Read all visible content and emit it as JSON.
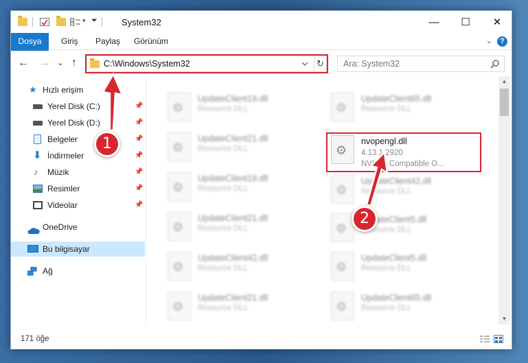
{
  "window": {
    "title": "System32",
    "controls": {
      "minimize": "—",
      "maximize": "☐",
      "close": "✕"
    }
  },
  "ribbon": {
    "tabs": [
      "Dosya",
      "Giriş",
      "Paylaş",
      "Görünüm"
    ],
    "help": "?"
  },
  "nav": {
    "back": "←",
    "forward": "→",
    "recent": "⌄",
    "up": "↑",
    "address": "C:\\Windows\\System32",
    "refresh": "↻",
    "search_placeholder": "Ara: System32"
  },
  "sidebar": {
    "items": [
      {
        "label": "Hızlı erişim",
        "icon": "star-icon",
        "pinned": false
      },
      {
        "label": "Yerel Disk (C:)",
        "icon": "drive-icon",
        "pinned": true
      },
      {
        "label": "Yerel Disk (D:)",
        "icon": "drive-icon",
        "pinned": true
      },
      {
        "label": "Belgeler",
        "icon": "documents-icon",
        "pinned": true
      },
      {
        "label": "İndirmeler",
        "icon": "downloads-icon",
        "pinned": true
      },
      {
        "label": "Müzik",
        "icon": "music-icon",
        "pinned": true
      },
      {
        "label": "Resimler",
        "icon": "pictures-icon",
        "pinned": true
      },
      {
        "label": "Videolar",
        "icon": "videos-icon",
        "pinned": true
      },
      {
        "label": "OneDrive",
        "icon": "cloud-icon",
        "pinned": false
      },
      {
        "label": "Bu bilgisayar",
        "icon": "computer-icon",
        "pinned": false
      },
      {
        "label": "Ağ",
        "icon": "network-icon",
        "pinned": false
      }
    ]
  },
  "files": {
    "left_column": [
      {
        "name": "UpdateClient19.dll",
        "desc": "Resource DLL"
      },
      {
        "name": "UpdateClient21.dll",
        "desc": "Resource DLL"
      },
      {
        "name": "UpdateClient19.dll",
        "desc": "Resource DLL"
      },
      {
        "name": "UpdateClient21.dll",
        "desc": "Resource DLL"
      },
      {
        "name": "UpdateClient42.dll",
        "desc": "Resource DLL"
      },
      {
        "name": "UpdateClient21.dll",
        "desc": "Resource DLL"
      }
    ],
    "right_column": [
      {
        "name": "UpdateClient65.dll",
        "desc": "Resource DLL"
      },
      {
        "name": "nvopengl.dll",
        "desc": "4.13.1.2920",
        "desc2": "NVIDIA Compatible O..."
      },
      {
        "name": "UpdateClient42.dll",
        "desc": "Resource DLL"
      },
      {
        "name": "UpdateClient5.dll",
        "desc": "Resource DLL"
      },
      {
        "name": "UpdateClient5.dll",
        "desc": "Resource DLL"
      },
      {
        "name": "UpdateClient65.dll",
        "desc": "Resource DLL"
      }
    ]
  },
  "status": {
    "count": "171 öğe"
  },
  "annotations": {
    "step1": "1",
    "step2": "2",
    "highlight_color": "#d8262f"
  }
}
